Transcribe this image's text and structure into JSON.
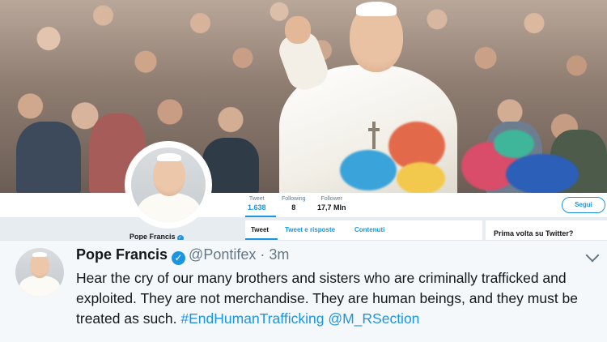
{
  "profile": {
    "name": "Pope Francis",
    "follow_label": "Segui",
    "stats": [
      {
        "label": "Tweet",
        "value": "1.638"
      },
      {
        "label": "Following",
        "value": "8"
      },
      {
        "label": "Follower",
        "value": "17,7 Mln"
      }
    ],
    "tabs": [
      {
        "label": "Tweet"
      },
      {
        "label": "Tweet e risposte"
      },
      {
        "label": "Contenuti"
      }
    ],
    "sidebar_title": "Prima volta su Twitter?"
  },
  "tweet": {
    "name": "Pope Francis",
    "handle": "@Pontifex",
    "separator": "·",
    "time": "3m",
    "text_line": "Hear the cry of our many brothers and sisters who are criminally trafficked and exploited. They are not merchandise. They are human beings, and they must be treated as such.",
    "hashtag": "#EndHumanTrafficking",
    "mention": "@M_RSection"
  },
  "icons": {
    "verified": "verified-badge-icon",
    "menu": "chevron-down-icon"
  },
  "colors": {
    "accent": "#1b95e0",
    "text": "#14171a",
    "muted": "#657786"
  }
}
